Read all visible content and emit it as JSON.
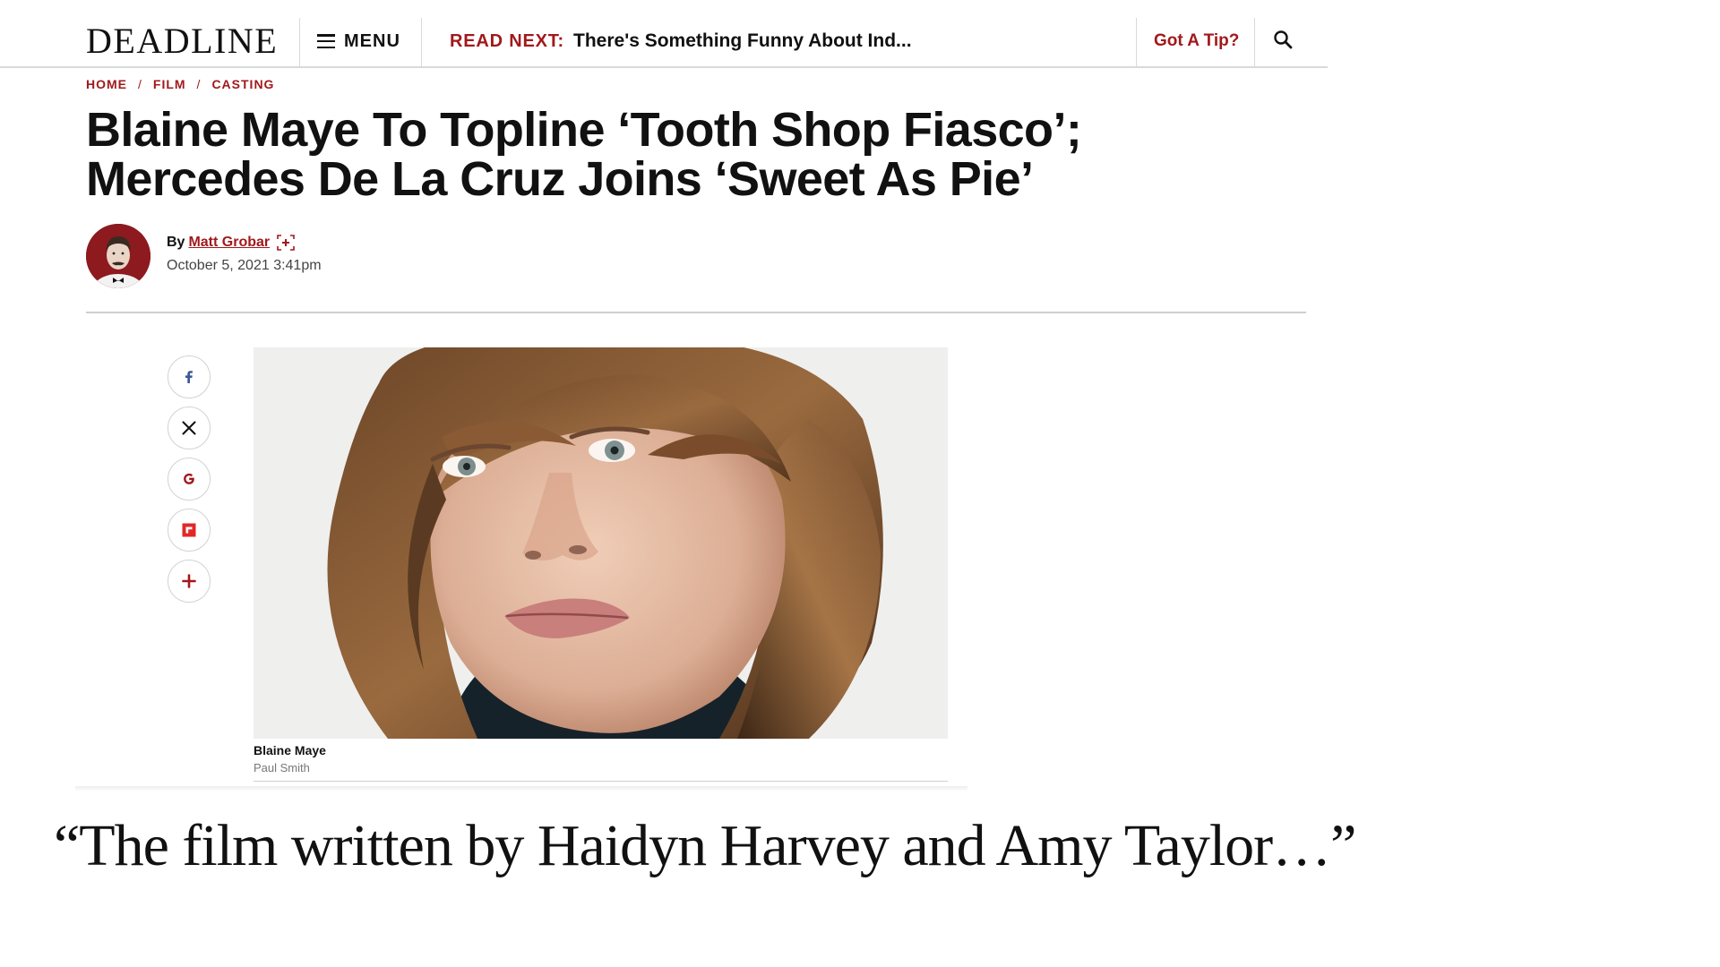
{
  "header": {
    "logo": "DEADLINE",
    "menu_label": "MENU",
    "read_next_label": "READ NEXT:",
    "read_next_title": "There's Something Funny About Ind...",
    "tip_label": "Got A Tip?"
  },
  "breadcrumb": {
    "items": [
      "HOME",
      "FILM",
      "CASTING"
    ],
    "separator": "/"
  },
  "article": {
    "headline_line1": "Blaine Maye To Topline ‘Tooth Shop Fiasco’;",
    "headline_line2": "Mercedes De La Cruz Joins ‘Sweet As Pie’",
    "byline_prefix": "By",
    "author": "Matt Grobar",
    "date": "October 5, 2021 3:41pm"
  },
  "share": {
    "icons": [
      "facebook-icon",
      "x-icon",
      "google-icon",
      "flipboard-icon",
      "plus-icon"
    ]
  },
  "photo": {
    "caption_name": "Blaine Maye",
    "caption_credit": "Paul Smith"
  },
  "quote": {
    "text": "“The film written by Haidyn Harvey and Amy Taylor…”"
  },
  "colors": {
    "brand_red": "#a1191c",
    "rule_gray": "#d9d9d9",
    "facebook_blue": "#3b5998"
  }
}
